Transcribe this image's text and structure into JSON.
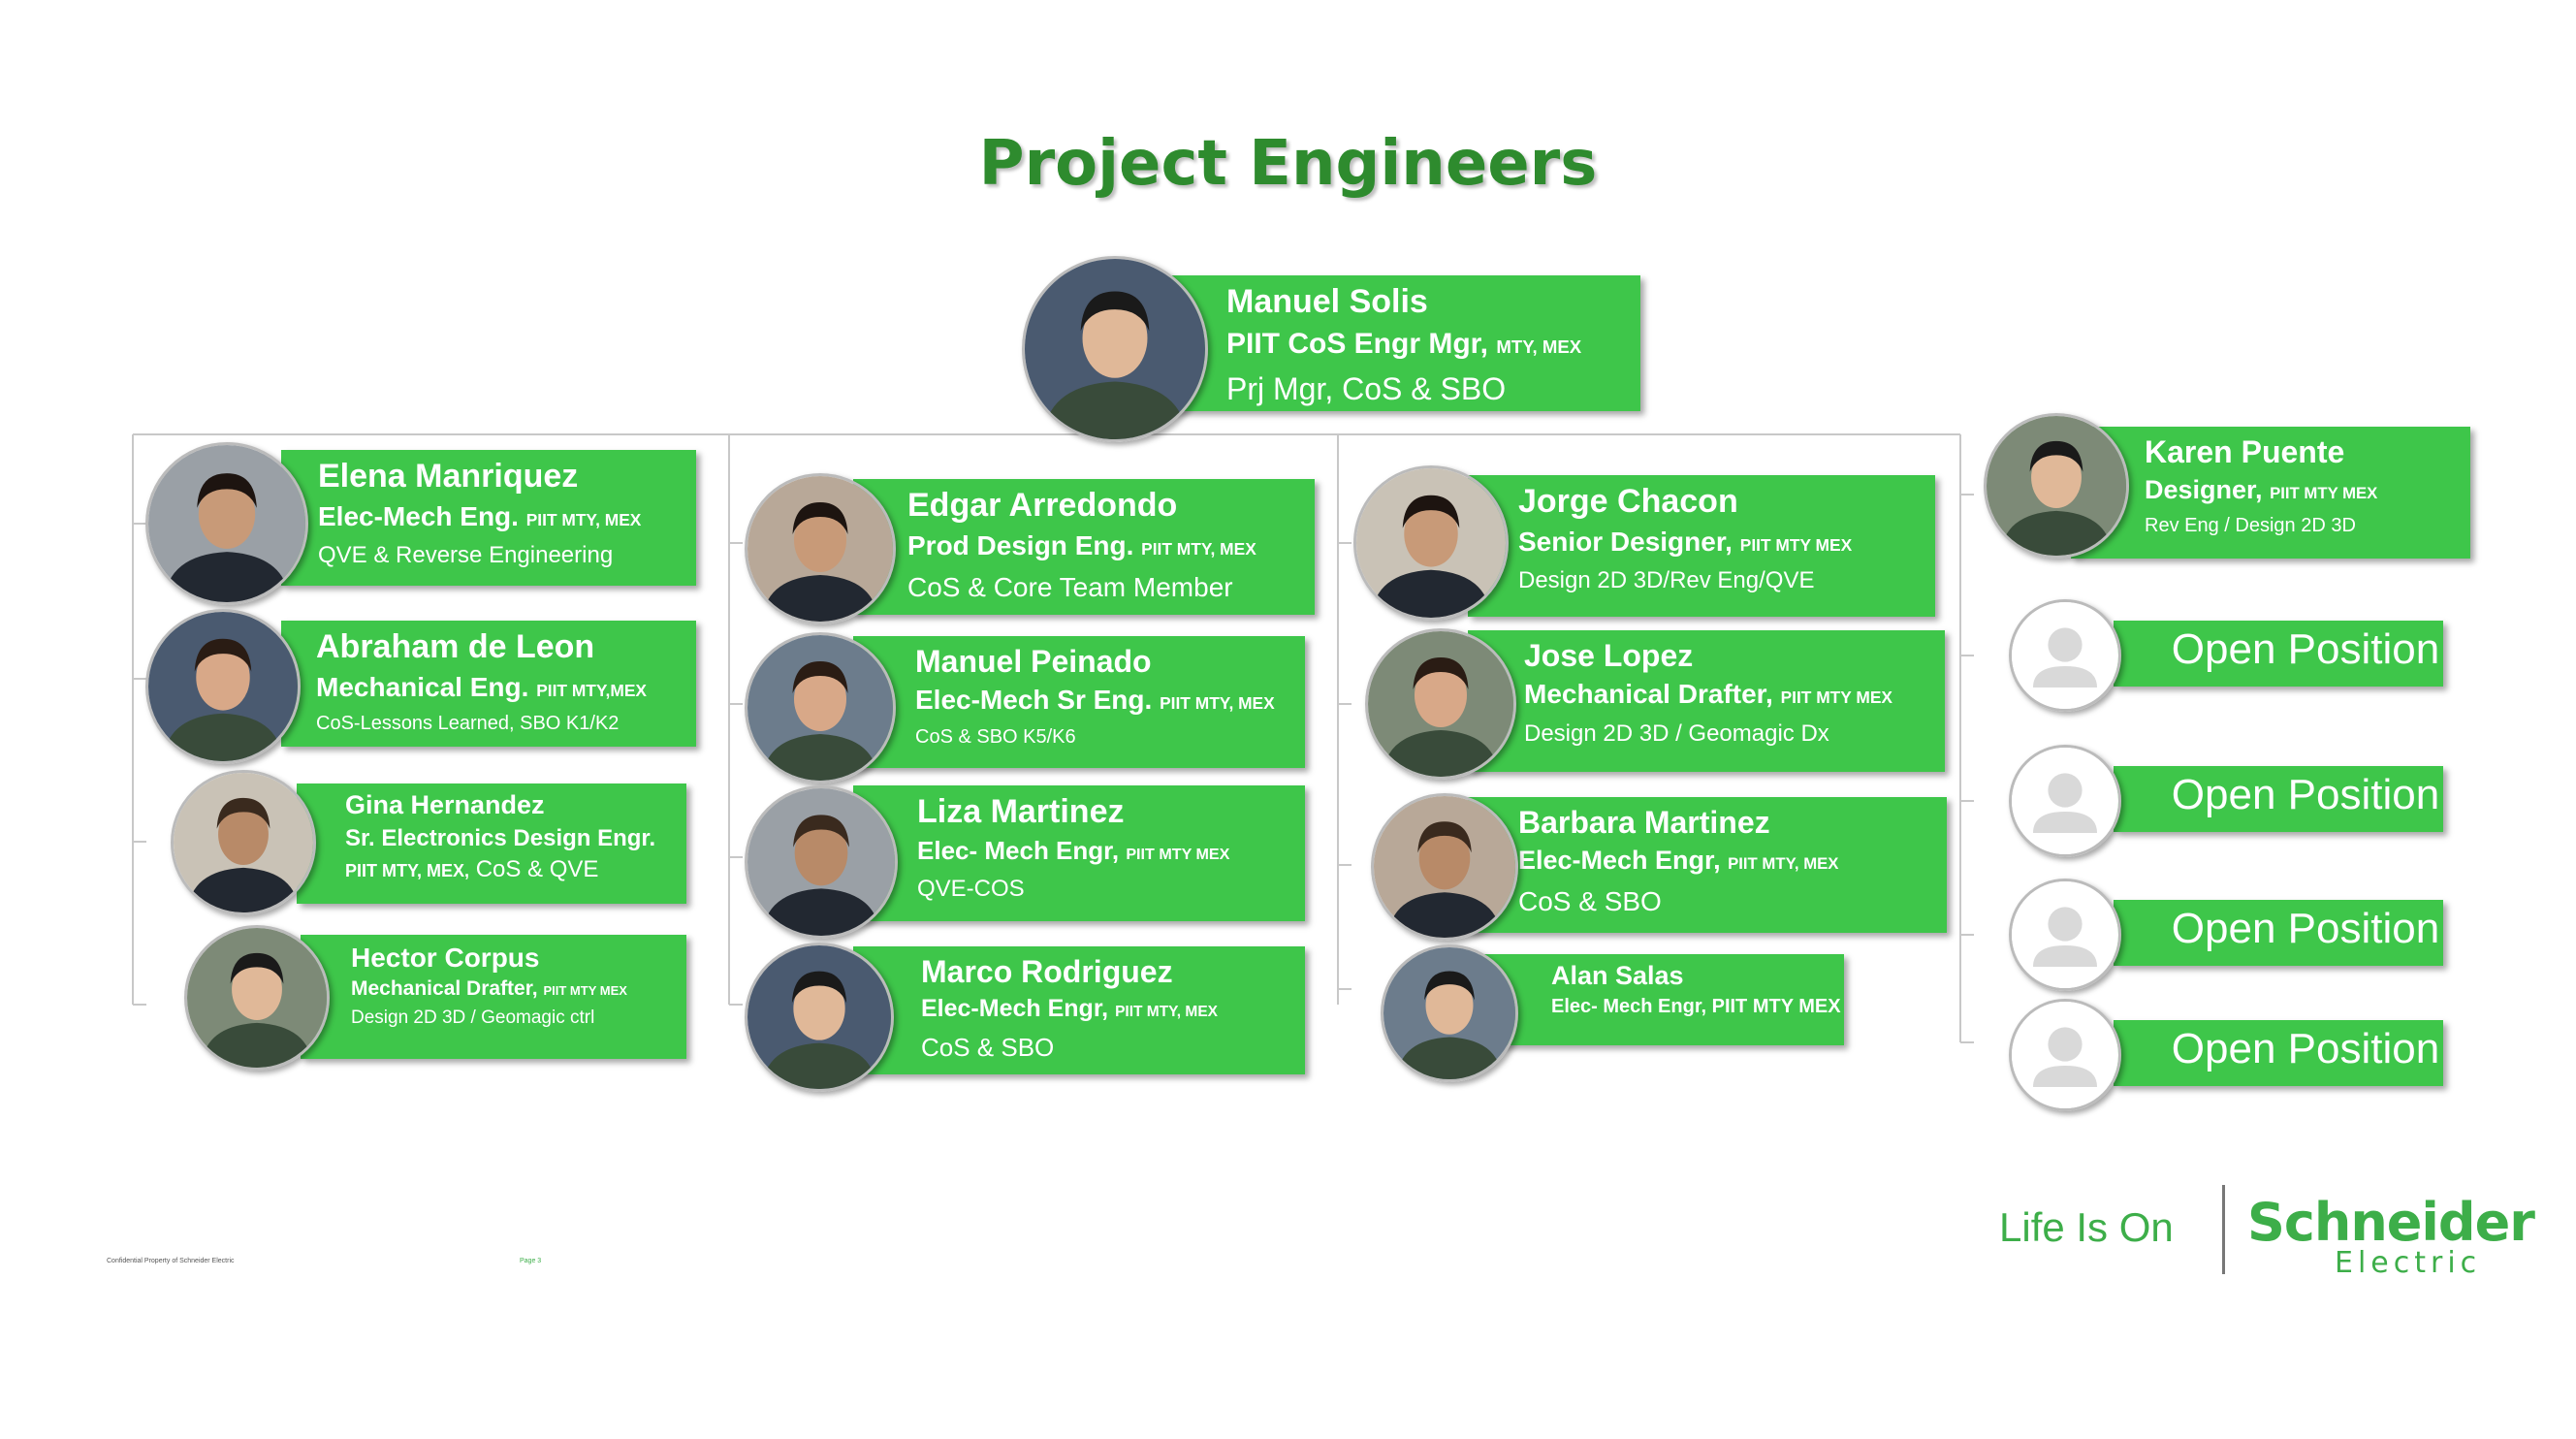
{
  "title": "Project Engineers",
  "colors": {
    "card": "#3ec64a",
    "title": "#2e8b2e",
    "connector": "#c8c8c8",
    "brand": "#3dae49"
  },
  "manager": {
    "name": "Manuel Solis",
    "role": "PIIT CoS Engr Mgr,",
    "role_loc": "MTY, MEX",
    "detail": "Prj Mgr, CoS & SBO"
  },
  "columns": [
    {
      "members": [
        {
          "name": "Elena Manriquez",
          "role": "Elec-Mech Eng.",
          "role_loc": "PIIT MTY, MEX",
          "detail": "QVE & Reverse Engineering"
        },
        {
          "name": "Abraham de Leon",
          "role": "Mechanical Eng.",
          "role_loc": "PIIT MTY,MEX",
          "detail": "CoS-Lessons Learned, SBO K1/K2"
        },
        {
          "name": "Gina Hernandez",
          "role": "Sr. Electronics Design Engr.",
          "role_loc": "",
          "detail_loc": "PIIT MTY, MEX,",
          "detail": "CoS & QVE"
        },
        {
          "name": "Hector Corpus",
          "role": "Mechanical Drafter,",
          "role_loc": "PIIT MTY MEX",
          "detail": "Design 2D 3D / Geomagic ctrl"
        }
      ]
    },
    {
      "members": [
        {
          "name": "Edgar Arredondo",
          "role": "Prod Design Eng.",
          "role_loc": "PIIT MTY, MEX",
          "detail": "CoS & Core Team Member"
        },
        {
          "name": "Manuel Peinado",
          "role": "Elec-Mech Sr Eng.",
          "role_loc": "PIIT MTY, MEX",
          "detail": "CoS & SBO K5/K6"
        },
        {
          "name": "Liza Martinez",
          "role": "Elec- Mech Engr,",
          "role_loc": "PIIT MTY MEX",
          "detail": "QVE-COS"
        },
        {
          "name": "Marco Rodriguez",
          "role": "Elec-Mech Engr,",
          "role_loc": "PIIT MTY, MEX",
          "detail": "CoS & SBO"
        }
      ]
    },
    {
      "members": [
        {
          "name": "Jorge Chacon",
          "role": "Senior Designer,",
          "role_loc": "PIIT MTY MEX",
          "detail": "Design 2D 3D/Rev Eng/QVE"
        },
        {
          "name": "Jose Lopez",
          "role": "Mechanical Drafter,",
          "role_loc": "PIIT MTY MEX",
          "detail": "Design 2D 3D / Geomagic Dx"
        },
        {
          "name": "Barbara Martinez",
          "role": "Elec-Mech Engr,",
          "role_loc": "PIIT MTY, MEX",
          "detail": "CoS & SBO"
        },
        {
          "name": "Alan Salas",
          "role": "Elec- Mech Engr, PIIT MTY MEX",
          "role_loc": "",
          "detail": ""
        }
      ]
    },
    {
      "members": [
        {
          "name": "Karen Puente",
          "role": "Designer,",
          "role_loc": "PIIT MTY MEX",
          "detail": "Rev Eng / Design 2D 3D"
        },
        {
          "name": "Open Position"
        },
        {
          "name": "Open Position"
        },
        {
          "name": "Open Position"
        },
        {
          "name": "Open Position"
        }
      ]
    }
  ],
  "footer": {
    "confidential": "Confidential Property of Schneider Electric",
    "page": "Page 3",
    "tagline": "Life Is On",
    "brand_line1": "Schneider",
    "brand_line2": "Electric"
  }
}
